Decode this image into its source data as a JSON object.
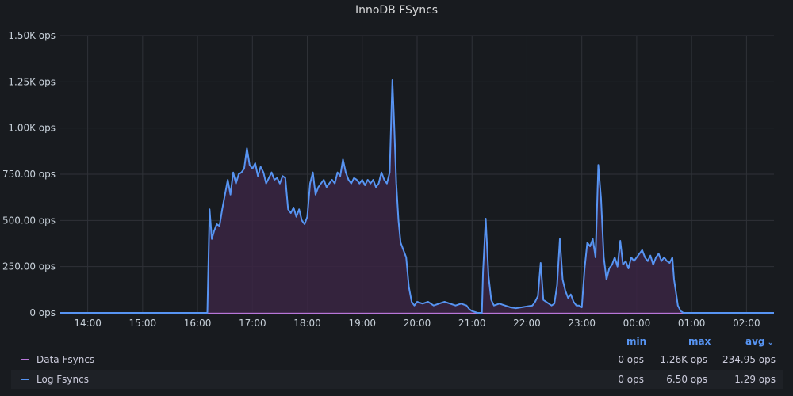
{
  "panel": {
    "title": "InnoDB FSyncs"
  },
  "chart_data": {
    "type": "area",
    "title": "InnoDB FSyncs",
    "x_ticks": [
      "14:00",
      "15:00",
      "16:00",
      "17:00",
      "18:00",
      "19:00",
      "20:00",
      "21:00",
      "22:00",
      "23:00",
      "00:00",
      "01:00",
      "02:00"
    ],
    "y_ticks": [
      "0 ops",
      "250.00 ops",
      "500.00 ops",
      "750.00 ops",
      "1.00K ops",
      "1.25K ops",
      "1.50K ops"
    ],
    "ylim": [
      0,
      1500
    ],
    "xlim_hours": [
      13.5,
      26.5
    ],
    "grid": true,
    "series": [
      {
        "name": "Log Fsyncs",
        "color": "#5794f2",
        "fill": "#3a2543",
        "points": [
          [
            13.5,
            0
          ],
          [
            16.18,
            0
          ],
          [
            16.2,
            280
          ],
          [
            16.22,
            560
          ],
          [
            16.26,
            400
          ],
          [
            16.3,
            440
          ],
          [
            16.35,
            480
          ],
          [
            16.4,
            470
          ],
          [
            16.45,
            560
          ],
          [
            16.5,
            640
          ],
          [
            16.55,
            720
          ],
          [
            16.6,
            640
          ],
          [
            16.65,
            760
          ],
          [
            16.7,
            700
          ],
          [
            16.75,
            750
          ],
          [
            16.8,
            760
          ],
          [
            16.85,
            780
          ],
          [
            16.9,
            890
          ],
          [
            16.95,
            800
          ],
          [
            17.0,
            780
          ],
          [
            17.05,
            810
          ],
          [
            17.1,
            740
          ],
          [
            17.15,
            790
          ],
          [
            17.2,
            760
          ],
          [
            17.25,
            700
          ],
          [
            17.3,
            730
          ],
          [
            17.35,
            760
          ],
          [
            17.4,
            720
          ],
          [
            17.45,
            730
          ],
          [
            17.5,
            700
          ],
          [
            17.55,
            740
          ],
          [
            17.6,
            730
          ],
          [
            17.65,
            560
          ],
          [
            17.7,
            540
          ],
          [
            17.75,
            570
          ],
          [
            17.8,
            520
          ],
          [
            17.85,
            560
          ],
          [
            17.9,
            500
          ],
          [
            17.95,
            480
          ],
          [
            18.0,
            520
          ],
          [
            18.05,
            700
          ],
          [
            18.1,
            760
          ],
          [
            18.15,
            640
          ],
          [
            18.2,
            680
          ],
          [
            18.25,
            700
          ],
          [
            18.3,
            720
          ],
          [
            18.35,
            680
          ],
          [
            18.4,
            700
          ],
          [
            18.45,
            720
          ],
          [
            18.5,
            700
          ],
          [
            18.55,
            760
          ],
          [
            18.6,
            740
          ],
          [
            18.65,
            830
          ],
          [
            18.7,
            760
          ],
          [
            18.75,
            720
          ],
          [
            18.8,
            700
          ],
          [
            18.85,
            730
          ],
          [
            18.9,
            720
          ],
          [
            18.95,
            700
          ],
          [
            19.0,
            720
          ],
          [
            19.05,
            690
          ],
          [
            19.1,
            720
          ],
          [
            19.15,
            700
          ],
          [
            19.2,
            720
          ],
          [
            19.25,
            680
          ],
          [
            19.3,
            700
          ],
          [
            19.35,
            760
          ],
          [
            19.4,
            720
          ],
          [
            19.45,
            700
          ],
          [
            19.5,
            760
          ],
          [
            19.55,
            1260
          ],
          [
            19.58,
            1040
          ],
          [
            19.62,
            700
          ],
          [
            19.66,
            500
          ],
          [
            19.7,
            380
          ],
          [
            19.75,
            340
          ],
          [
            19.8,
            300
          ],
          [
            19.85,
            140
          ],
          [
            19.9,
            60
          ],
          [
            19.95,
            40
          ],
          [
            20.0,
            60
          ],
          [
            20.1,
            50
          ],
          [
            20.2,
            60
          ],
          [
            20.3,
            40
          ],
          [
            20.4,
            50
          ],
          [
            20.5,
            60
          ],
          [
            20.6,
            50
          ],
          [
            20.7,
            40
          ],
          [
            20.8,
            50
          ],
          [
            20.9,
            40
          ],
          [
            20.95,
            20
          ],
          [
            21.0,
            10
          ],
          [
            21.1,
            0
          ],
          [
            21.18,
            0
          ],
          [
            21.2,
            220
          ],
          [
            21.25,
            510
          ],
          [
            21.3,
            200
          ],
          [
            21.35,
            70
          ],
          [
            21.4,
            40
          ],
          [
            21.5,
            50
          ],
          [
            21.6,
            40
          ],
          [
            21.7,
            30
          ],
          [
            21.8,
            25
          ],
          [
            21.9,
            30
          ],
          [
            22.0,
            35
          ],
          [
            22.1,
            40
          ],
          [
            22.15,
            60
          ],
          [
            22.2,
            90
          ],
          [
            22.25,
            270
          ],
          [
            22.3,
            70
          ],
          [
            22.35,
            60
          ],
          [
            22.45,
            40
          ],
          [
            22.5,
            50
          ],
          [
            22.55,
            150
          ],
          [
            22.6,
            400
          ],
          [
            22.65,
            180
          ],
          [
            22.7,
            120
          ],
          [
            22.75,
            80
          ],
          [
            22.8,
            100
          ],
          [
            22.85,
            60
          ],
          [
            22.9,
            40
          ],
          [
            22.95,
            40
          ],
          [
            23.0,
            30
          ],
          [
            23.05,
            240
          ],
          [
            23.1,
            380
          ],
          [
            23.15,
            360
          ],
          [
            23.2,
            400
          ],
          [
            23.25,
            300
          ],
          [
            23.3,
            800
          ],
          [
            23.35,
            620
          ],
          [
            23.4,
            300
          ],
          [
            23.45,
            180
          ],
          [
            23.5,
            240
          ],
          [
            23.55,
            260
          ],
          [
            23.6,
            300
          ],
          [
            23.65,
            250
          ],
          [
            23.7,
            390
          ],
          [
            23.75,
            260
          ],
          [
            23.8,
            280
          ],
          [
            23.85,
            240
          ],
          [
            23.9,
            300
          ],
          [
            23.95,
            280
          ],
          [
            24.0,
            300
          ],
          [
            24.05,
            320
          ],
          [
            24.1,
            340
          ],
          [
            24.15,
            300
          ],
          [
            24.2,
            280
          ],
          [
            24.25,
            310
          ],
          [
            24.3,
            260
          ],
          [
            24.35,
            300
          ],
          [
            24.4,
            320
          ],
          [
            24.45,
            280
          ],
          [
            24.5,
            300
          ],
          [
            24.55,
            280
          ],
          [
            24.6,
            270
          ],
          [
            24.65,
            300
          ],
          [
            24.68,
            180
          ],
          [
            24.72,
            100
          ],
          [
            24.75,
            40
          ],
          [
            24.8,
            10
          ],
          [
            24.85,
            0
          ],
          [
            26.5,
            0
          ]
        ]
      },
      {
        "name": "Data Fsyncs",
        "color": "#b877d9",
        "fill": "#3a2543",
        "points": [
          [
            13.5,
            0
          ],
          [
            26.5,
            0
          ]
        ]
      }
    ]
  },
  "legend": {
    "headers": {
      "min": "min",
      "max": "max",
      "avg": "avg"
    },
    "rows": [
      {
        "name": "Data Fsyncs",
        "color": "#b877d9",
        "min": "0 ops",
        "max": "1.26K ops",
        "avg": "234.95 ops"
      },
      {
        "name": "Log Fsyncs",
        "color": "#5794f2",
        "min": "0 ops",
        "max": "6.50 ops",
        "avg": "1.29 ops"
      }
    ]
  }
}
